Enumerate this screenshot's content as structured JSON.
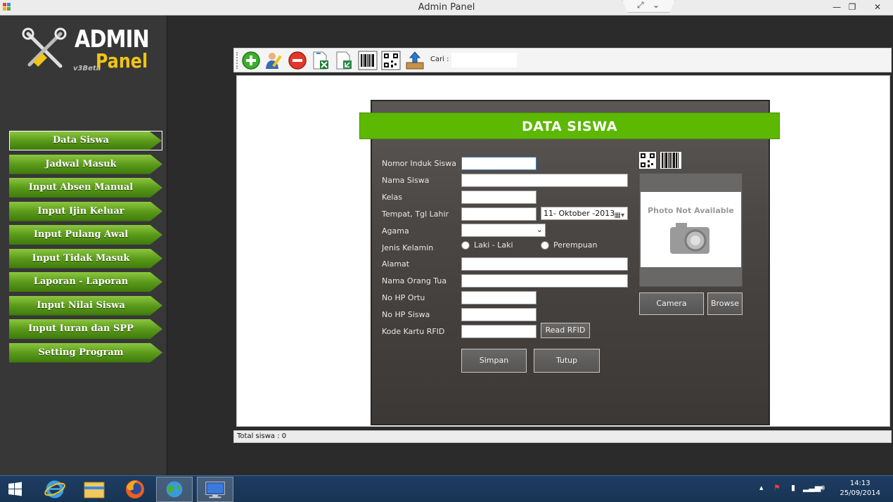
{
  "window": {
    "title": "Admin Panel",
    "minimize": "—",
    "maximize": "❐",
    "close": "✕"
  },
  "logo": {
    "word1": "ADMIN",
    "word2": "Panel",
    "version": "v3Beta"
  },
  "menu": {
    "items": [
      {
        "label": "Data Siswa"
      },
      {
        "label": "Jadwal Masuk"
      },
      {
        "label": "Input Absen Manual"
      },
      {
        "label": "Input Ijin Keluar"
      },
      {
        "label": "Input Pulang Awal"
      },
      {
        "label": "Input Tidak Masuk"
      },
      {
        "label": "Laporan - Laporan"
      },
      {
        "label": "Input Nilai Siswa"
      },
      {
        "label": "Input Iuran dan SPP"
      },
      {
        "label": "Setting Program"
      }
    ]
  },
  "toolbar": {
    "search_label": "Cari :",
    "search_value": ""
  },
  "form": {
    "title": "DATA SISWA",
    "labels": {
      "nis": "Nomor Induk Siswa",
      "nama": "Nama Siswa",
      "kelas": "Kelas",
      "ttl": "Tempat, Tgl Lahir",
      "agama": "Agama",
      "jk": "Jenis Kelamin",
      "alamat": "Alamat",
      "ortu": "Nama Orang Tua",
      "hp_ortu": "No HP Ortu",
      "hp_siswa": "No HP Siswa",
      "rfid": "Kode Kartu RFID"
    },
    "date_value": "11- Oktober -2013",
    "radio_male": "Laki - Laki",
    "radio_female": "Perempuan",
    "read_rfid": "Read RFID",
    "save": "Simpan",
    "close": "Tutup",
    "photo_text": "Photo Not Available",
    "camera": "Camera",
    "browse": "Browse"
  },
  "status": {
    "total": "Total siswa : 0"
  },
  "taskbar": {
    "time": "14:13",
    "date": "25/09/2014"
  }
}
